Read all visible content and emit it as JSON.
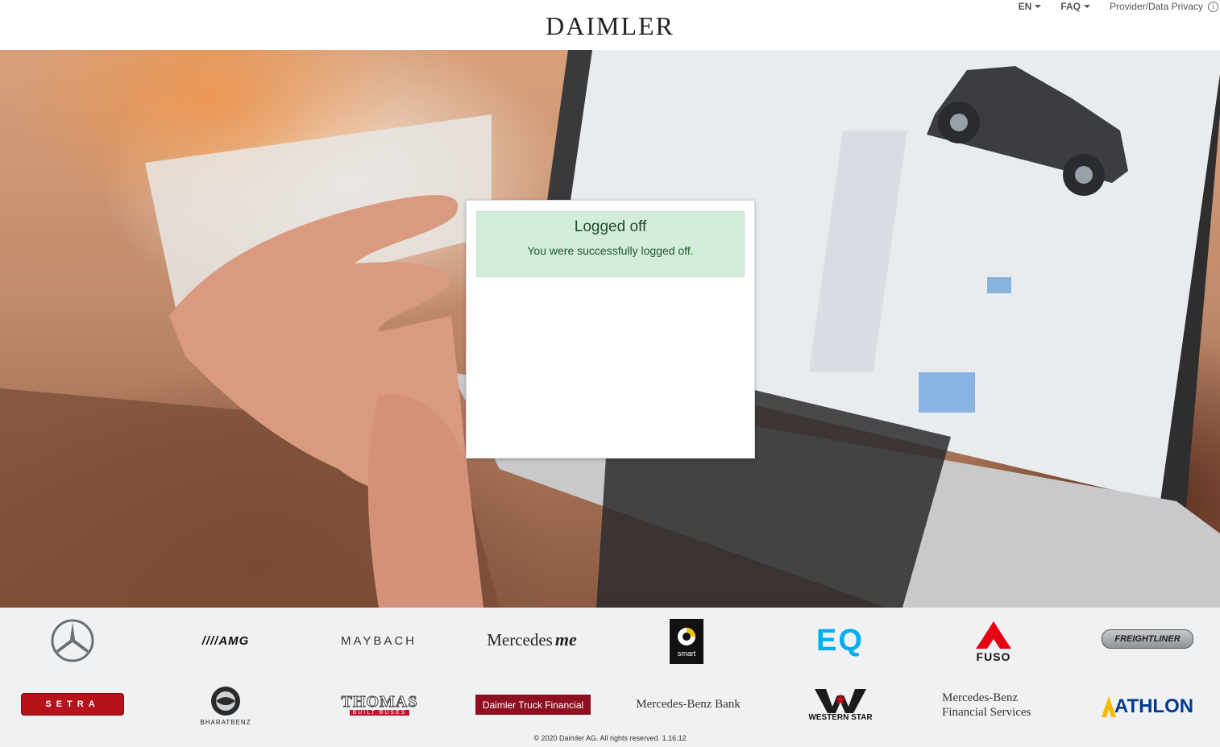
{
  "header": {
    "brand": "DAIMLER",
    "language": "EN",
    "faq": "FAQ",
    "provider": "Provider/Data Privacy",
    "info_glyph": "i"
  },
  "dialog": {
    "title": "Logged off",
    "message": "You were successfully logged off."
  },
  "brands": {
    "amg": "AMG",
    "maybach": "MAYBACH",
    "mercedes_me_word": "Mercedes",
    "mercedes_me_me": "me",
    "smart": "smart",
    "eq": "EQ",
    "fuso": "FUSO",
    "freightliner": "FREIGHTLINER",
    "setra": "SETRA",
    "bharatbenz": "BHARATBENZ",
    "thomas": "THOMAS",
    "thomas_sub": "BUILT BUSES",
    "daimler_truck_financial": "Daimler Truck Financial",
    "mercedes_benz_bank": "Mercedes-Benz Bank",
    "western_star": "WESTERN STAR",
    "mbfs_line1": "Mercedes-Benz",
    "mbfs_line2": "Financial Services",
    "athlon": "ATHLON"
  },
  "footer": {
    "copyright": "© 2020 Daimler AG. All rights reserved.  1.16.12"
  },
  "colors": {
    "success_bg": "#d4edda",
    "success_text": "#155724",
    "eq_blue": "#00adef",
    "fuso_red": "#e60012",
    "setra_red": "#b5121b",
    "dtf_red": "#8e1020",
    "athlon_blue": "#003a8c",
    "athlon_yellow": "#f6b800"
  }
}
